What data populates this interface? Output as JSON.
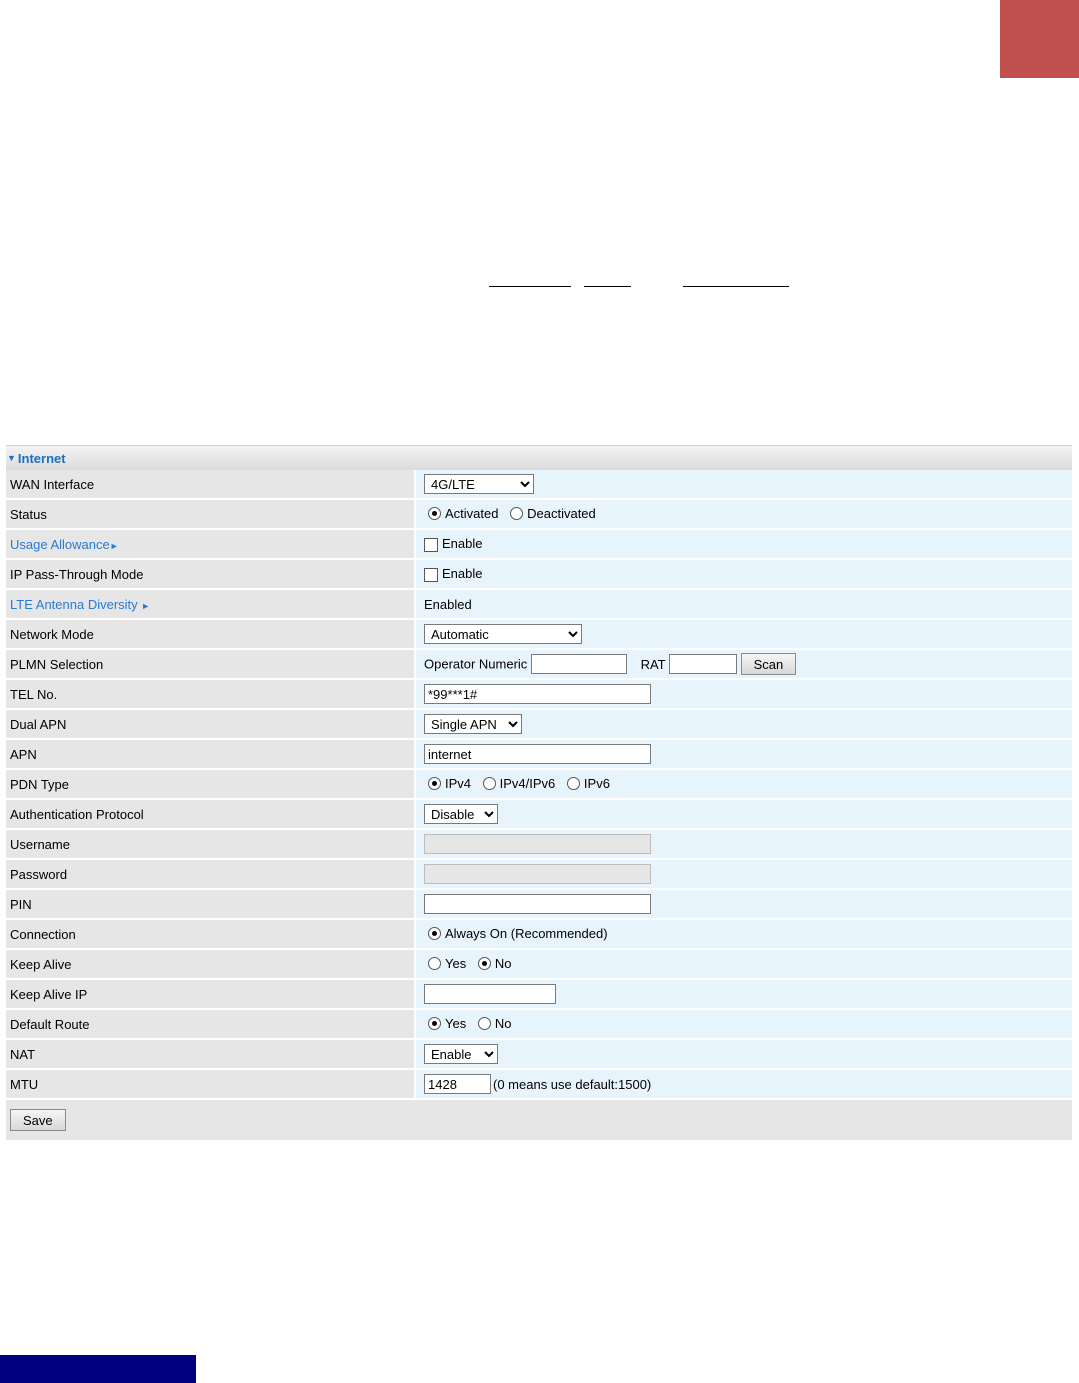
{
  "panel": {
    "title": "Internet"
  },
  "rows": {
    "wan_interface": {
      "label": "WAN Interface",
      "value": "4G/LTE"
    },
    "status": {
      "label": "Status",
      "opt1": "Activated",
      "opt2": "Deactivated"
    },
    "usage_allowance": {
      "label": "Usage Allowance",
      "check": "Enable"
    },
    "ip_passthrough": {
      "label": "IP Pass-Through Mode",
      "check": "Enable"
    },
    "lte_antenna": {
      "label": "LTE Antenna Diversity",
      "value": "Enabled"
    },
    "network_mode": {
      "label": "Network Mode",
      "value": "Automatic"
    },
    "plmn": {
      "label": "PLMN Selection",
      "operator_label": "Operator Numeric",
      "rat_label": "RAT",
      "scan": "Scan"
    },
    "tel_no": {
      "label": "TEL No.",
      "value": "*99***1#"
    },
    "dual_apn": {
      "label": "Dual APN",
      "value": "Single APN"
    },
    "apn": {
      "label": "APN",
      "value": "internet"
    },
    "pdn_type": {
      "label": "PDN Type",
      "opt1": "IPv4",
      "opt2": "IPv4/IPv6",
      "opt3": "IPv6"
    },
    "auth": {
      "label": "Authentication Protocol",
      "value": "Disable"
    },
    "username": {
      "label": "Username"
    },
    "password": {
      "label": "Password"
    },
    "pin": {
      "label": "PIN"
    },
    "connection": {
      "label": "Connection",
      "opt1": "Always On (Recommended)"
    },
    "keep_alive": {
      "label": "Keep Alive",
      "opt1": "Yes",
      "opt2": "No"
    },
    "keep_alive_ip": {
      "label": "Keep Alive IP"
    },
    "default_route": {
      "label": "Default Route",
      "opt1": "Yes",
      "opt2": "No"
    },
    "nat": {
      "label": "NAT",
      "value": "Enable"
    },
    "mtu": {
      "label": "MTU",
      "value": "1428",
      "note": "(0 means use default:1500)"
    }
  },
  "save_label": "Save",
  "colors": {
    "accent": "#c0504d",
    "footer": "#000080",
    "link": "#2a7ad3"
  }
}
